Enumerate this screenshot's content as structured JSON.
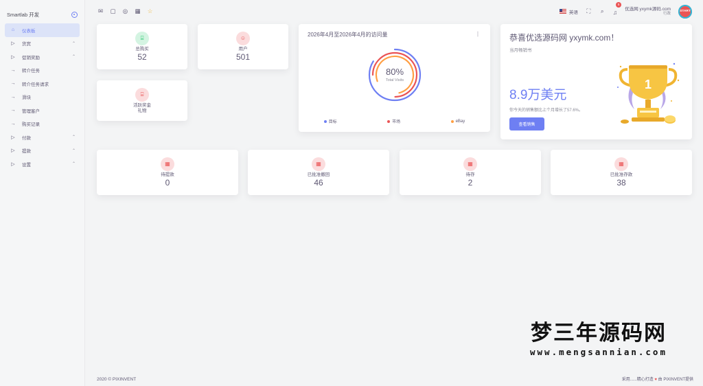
{
  "brand": {
    "name": "Smartlab 开发"
  },
  "sidebar": {
    "items": [
      {
        "label": "仪表板",
        "icon": "home-icon",
        "chevron": ""
      },
      {
        "label": "货宾",
        "icon": "play-icon",
        "chevron": "⌃"
      },
      {
        "label": "促销奖励",
        "icon": "play-icon",
        "chevron": "⌃"
      },
      {
        "label": "转介任务",
        "icon": "arrow-right-icon",
        "chevron": ""
      },
      {
        "label": "转介任务请求",
        "icon": "arrow-right-icon",
        "chevron": ""
      },
      {
        "label": "滑块",
        "icon": "arrow-right-icon",
        "chevron": ""
      },
      {
        "label": "管理客户",
        "icon": "arrow-right-icon",
        "chevron": ""
      },
      {
        "label": "购买记录",
        "icon": "arrow-right-icon",
        "chevron": ""
      },
      {
        "label": "付款",
        "icon": "play-icon",
        "chevron": "⌃"
      },
      {
        "label": "提款",
        "icon": "play-icon",
        "chevron": "⌃"
      },
      {
        "label": "设置",
        "icon": "play-icon",
        "chevron": "⌃"
      }
    ]
  },
  "topbar": {
    "icons": [
      "mail-icon",
      "chat-icon",
      "check-circle-icon",
      "calendar-icon",
      "star-icon"
    ],
    "language": "英语",
    "notification_count": "5",
    "user_name": "优选网 yxymk源码.com",
    "user_role": "行政",
    "avatar_text": "START"
  },
  "stats_top": [
    {
      "label": "总购买",
      "value": "52",
      "icon": "bag-icon",
      "tone": "green"
    },
    {
      "label": "用户",
      "value": "501",
      "icon": "user-icon",
      "tone": "red"
    }
  ],
  "stat_bonus": {
    "label": "活跃奖金",
    "sublabel": "礼物",
    "icon": "bag-icon",
    "tone": "red"
  },
  "visits": {
    "title": "2026年4月至2026年4月的访问量",
    "percent": "80%",
    "subtitle": "Total Visits",
    "legend": [
      {
        "label": "目标",
        "color": "#6e7ff3"
      },
      {
        "label": "市场",
        "color": "#ea5455"
      },
      {
        "label": "eBay",
        "color": "#ff9f43"
      }
    ]
  },
  "congrats": {
    "title": "恭喜优选源码网 yxymk.com！",
    "subtitle": "当月畅销书",
    "amount": "8.9万美元",
    "description": "你今天的销售额比上个月增长了57.6%。",
    "button": "查看销售",
    "trophy_number": "1"
  },
  "stats_bottom": [
    {
      "label": "待提款",
      "value": "0"
    },
    {
      "label": "已批准撤回",
      "value": "46"
    },
    {
      "label": "待存",
      "value": "2"
    },
    {
      "label": "已批准存款",
      "value": "38"
    }
  ],
  "footer": {
    "copyright": "2020 © PIXINVENT",
    "credit_prefix": "采用......精心打造",
    "credit_suffix": "由 PIXINVENT提供"
  },
  "watermark": {
    "cn": "梦三年源码网",
    "url": "www.mengsannian.com"
  },
  "colors": {
    "accent": "#6e7ff3",
    "danger": "#ea5455",
    "success": "#28c76f",
    "warning": "#ff9f43"
  }
}
